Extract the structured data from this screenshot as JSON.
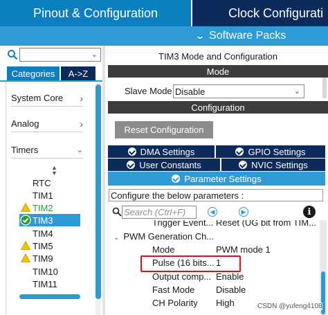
{
  "header": {
    "tab_pinout": "Pinout & Configuration",
    "tab_clock": "Clock Configurati",
    "software_packs": "Software Packs"
  },
  "sidebar": {
    "search_value": "",
    "tab_categories": "Categories",
    "tab_az": "A->Z",
    "categories": [
      {
        "label": "System Core",
        "arrow": ">"
      },
      {
        "label": "Analog",
        "arrow": ">"
      },
      {
        "label": "Timers",
        "arrow": "v"
      }
    ],
    "timers": [
      {
        "label": "RTC",
        "state": "normal"
      },
      {
        "label": "TIM1",
        "state": "normal"
      },
      {
        "label": "TIM2",
        "state": "warning"
      },
      {
        "label": "TIM3",
        "state": "selected"
      },
      {
        "label": "TIM4",
        "state": "normal"
      },
      {
        "label": "TIM5",
        "state": "warning"
      },
      {
        "label": "TIM9",
        "state": "warning"
      },
      {
        "label": "TIM10",
        "state": "normal"
      },
      {
        "label": "TIM11",
        "state": "normal"
      }
    ]
  },
  "main": {
    "title": "TIM3 Mode and Configuration",
    "mode_header": "Mode",
    "slave_mode_label": "Slave Mode",
    "slave_mode_value": "Disable",
    "configuration_header": "Configuration",
    "reset_button": "Reset Configuration",
    "tabs": {
      "dma": "DMA Settings",
      "gpio": "GPIO Settings",
      "user_constants": "User Constants",
      "nvic": "NVIC Settings",
      "parameter": "Parameter Settings"
    },
    "configure_prompt": "Configure the below parameters :",
    "search_placeholder": "Search (Ctrl+F)",
    "trigger_partial": {
      "name": "Trigger Event...",
      "value": "Reset (UG bit from TIM..."
    },
    "group": "PWM Generation Ch...",
    "params": [
      {
        "name": "Mode",
        "value": "PWM mode 1"
      },
      {
        "name": "Pulse (16 bits...",
        "value": "1"
      },
      {
        "name": "Output comp...",
        "value": "Enable"
      },
      {
        "name": "Fast Mode",
        "value": "Disable"
      },
      {
        "name": "CH Polarity",
        "value": "High"
      }
    ]
  },
  "watermark": "CSDN @yufeng4108",
  "colors": {
    "accent_blue": "#2e9bd6",
    "dark_navy": "#0c2b5a",
    "tab_blue": "#0b7fbf",
    "header_gray": "#3d3d3d",
    "highlight_red": "#e01010",
    "warning_yellow": "#f2c200",
    "ok_green": "#2e9a2e"
  }
}
